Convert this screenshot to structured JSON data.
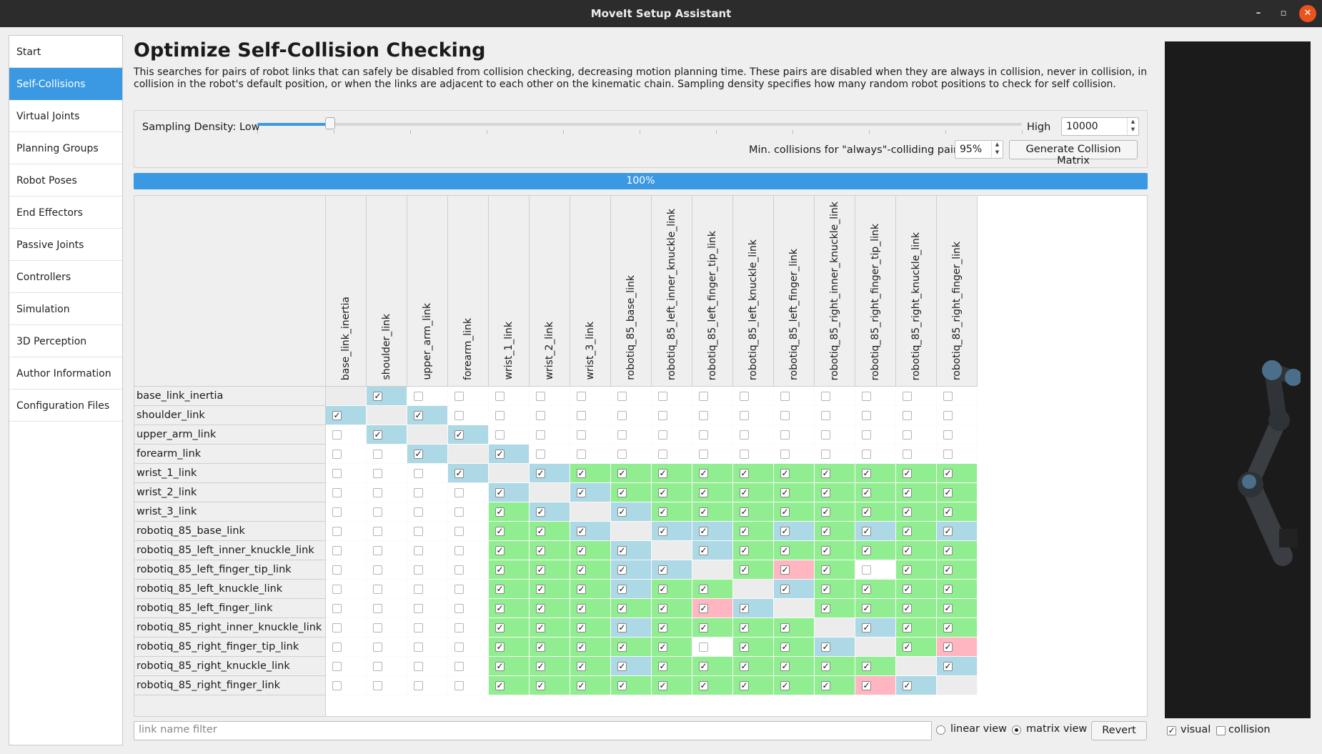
{
  "window": {
    "title": "MoveIt Setup Assistant",
    "minimize": "–",
    "maximize": "▫",
    "close": "✕"
  },
  "sidebar": {
    "items": [
      {
        "label": "Start"
      },
      {
        "label": "Self-Collisions",
        "active": true
      },
      {
        "label": "Virtual Joints"
      },
      {
        "label": "Planning Groups"
      },
      {
        "label": "Robot Poses"
      },
      {
        "label": "End Effectors"
      },
      {
        "label": "Passive Joints"
      },
      {
        "label": "Controllers"
      },
      {
        "label": "Simulation"
      },
      {
        "label": "3D Perception"
      },
      {
        "label": "Author Information"
      },
      {
        "label": "Configuration Files"
      }
    ]
  },
  "header": {
    "title": "Optimize Self-Collision Checking",
    "description": "This searches for pairs of robot links that can safely be disabled from collision checking, decreasing motion planning time. These pairs are disabled when they are always in collision, never in collision, in collision in the robot's default position, or when the links are adjacent to each other on the kinematic chain. Sampling density specifies how many random robot positions to check for self collision."
  },
  "density": {
    "label_low": "Sampling Density: Low",
    "label_high": "High",
    "slider_fraction": 0.095,
    "samples_value": "10000",
    "min_collisions_label": "Min. collisions for \"always\"-colliding pairs:",
    "min_collisions_value": "95%",
    "generate_button": "Generate Collision Matrix"
  },
  "progress": {
    "value": 100,
    "text": "100%",
    "color": "#3b99e4"
  },
  "matrix": {
    "links": [
      "base_link_inertia",
      "shoulder_link",
      "upper_arm_link",
      "forearm_link",
      "wrist_1_link",
      "wrist_2_link",
      "wrist_3_link",
      "robotiq_85_base_link",
      "robotiq_85_left_inner_knuckle_link",
      "robotiq_85_left_finger_tip_link",
      "robotiq_85_left_knuckle_link",
      "robotiq_85_left_finger_link",
      "robotiq_85_right_inner_knuckle_link",
      "robotiq_85_right_finger_tip_link",
      "robotiq_85_right_knuckle_link",
      "robotiq_85_right_finger_link"
    ],
    "legend_colors": {
      "A": "#add8e6",
      "N": "#90ee90",
      "C": "#ffb6c1",
      "D": "#ececec",
      "B": "#ffffff"
    },
    "cell_state_key": "A=adjacent checked, N=never-in-collision checked, C=always-in-collision checked, D=diagonal, B=unchecked, c=always-in-collision unchecked, b=unchecked on white background",
    "rows": [
      "DABBBBBBBBBBBBBB",
      "ADABBBBBBBBBBBBB",
      "BADABBBBBBBBBBBB",
      "BBADABBBBBBBBBBB",
      "BBBADANNNNNNNNNN",
      "BBBBADANNNNNNNNN",
      "BBBBNADANNNNNNNN",
      "BBBBNNADAANANANA",
      "BBBBNNNADANNNNNN",
      "BBBBNNNAADNCNbNN",
      "BBBBNNNANNDANNNN",
      "BBBBNNNNNCADNNNN",
      "BBBBNNNANNNNDANN",
      "BBBBNNNNNbNNADNC",
      "BBBBNNNANNNNNNDA",
      "BBBBNNNNNNNNNCAD"
    ]
  },
  "footer": {
    "filter_placeholder": "link name filter",
    "linear_view": "linear view",
    "matrix_view": "matrix view",
    "selected_view": "matrix",
    "revert_button": "Revert",
    "visual_label": "visual",
    "visual_checked": true,
    "collision_label": "collision",
    "collision_checked": false
  }
}
